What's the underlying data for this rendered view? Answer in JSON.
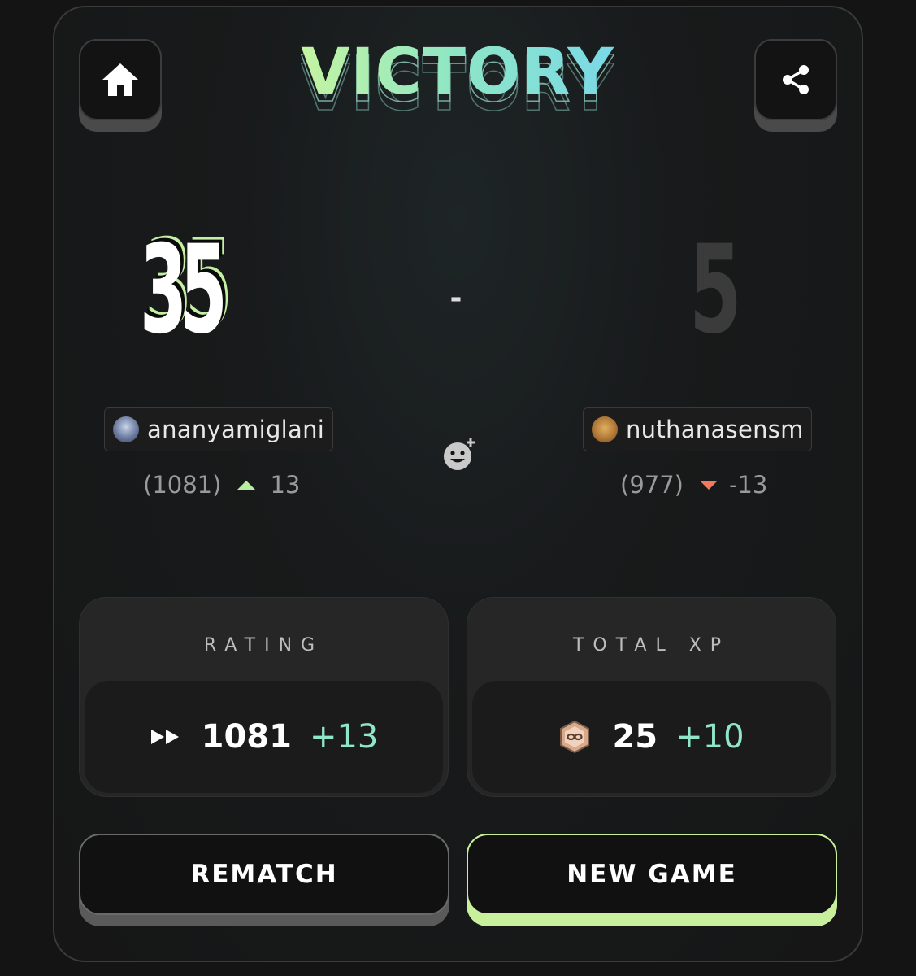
{
  "header": {
    "title": "VICTORY",
    "home_icon": "home-icon",
    "share_icon": "share-icon"
  },
  "score": {
    "left": "35",
    "separator": "-",
    "right": "5"
  },
  "players": {
    "left": {
      "name": "ananyamiglani",
      "rating": "(1081)",
      "change": "13",
      "trend": "up"
    },
    "right": {
      "name": "nuthanasensm",
      "rating": "(977)",
      "change": "-13",
      "trend": "down"
    }
  },
  "stats": {
    "rating": {
      "label": "RATING",
      "value": "1081",
      "delta": "+13",
      "icon": "fast-forward-icon"
    },
    "xp": {
      "label": "TOTAL XP",
      "value": "25",
      "delta": "+10",
      "icon": "xp-badge-icon"
    }
  },
  "actions": {
    "rematch": "REMATCH",
    "new_game": "NEW GAME"
  },
  "colors": {
    "accent_green": "#c8f09c",
    "delta_teal": "#8fe6c8",
    "up": "#b8eea0",
    "down": "#f07a5e"
  }
}
